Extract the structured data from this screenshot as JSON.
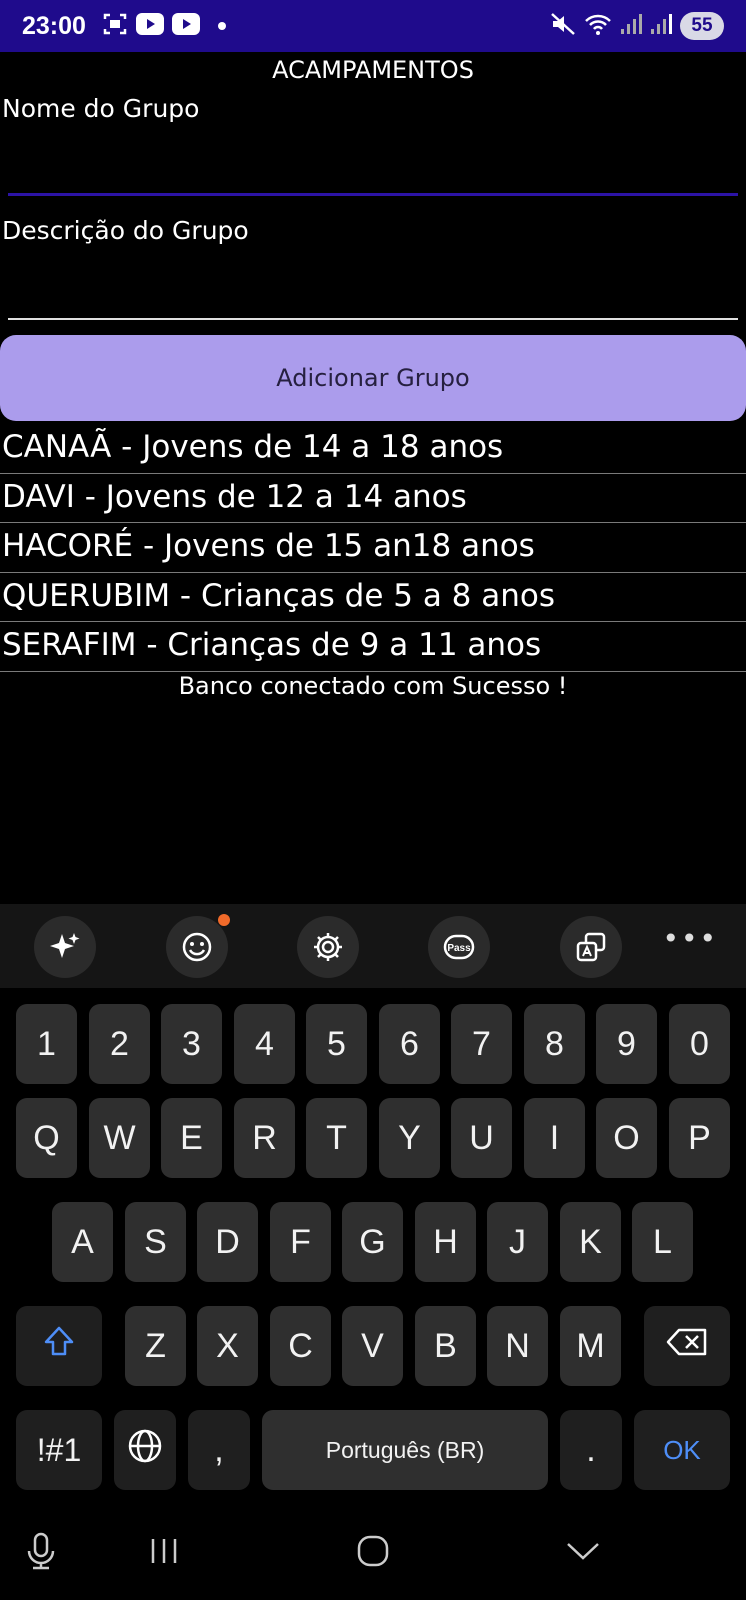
{
  "status_bar": {
    "time": "23:00",
    "battery": "55",
    "icons": [
      "screenshot-icon",
      "youtube-icon",
      "youtube-icon",
      "mute-icon",
      "wifi-icon",
      "signal-icon",
      "signal-icon"
    ]
  },
  "app": {
    "title": "ACAMPAMENTOS",
    "name_label": "Nome do Grupo",
    "name_value": "",
    "description_label": "Descrição do Grupo",
    "description_value": "",
    "add_button": "Adicionar Grupo",
    "groups": [
      "CANAÃ - Jovens de 14 a 18 anos",
      "DAVI - Jovens de 12 a 14 anos",
      "HACORÉ - Jovens de 15 an18 anos",
      "QUERUBIM - Crianças de 5 a 8 anos",
      "SERAFIM - Crianças de 9 a 11 anos"
    ],
    "status_message": "Banco conectado com Sucesso !"
  },
  "keyboard": {
    "toolbar": [
      "ai-sparkle-icon",
      "emoji-icon",
      "settings-icon",
      "pass-icon",
      "translate-icon",
      "more-icon"
    ],
    "more": "•••",
    "pass_label": "Pass",
    "row_numbers": [
      "1",
      "2",
      "3",
      "4",
      "5",
      "6",
      "7",
      "8",
      "9",
      "0"
    ],
    "row_top": [
      "Q",
      "W",
      "E",
      "R",
      "T",
      "Y",
      "U",
      "I",
      "O",
      "P"
    ],
    "row_middle": [
      "A",
      "S",
      "D",
      "F",
      "G",
      "H",
      "J",
      "K",
      "L"
    ],
    "row_bottom": [
      "Z",
      "X",
      "C",
      "V",
      "B",
      "N",
      "M"
    ],
    "symbols_key": "!#1",
    "comma_key": ",",
    "space_label": "Português (BR)",
    "period_key": ".",
    "ok_key": "OK"
  },
  "nav_bar": [
    "microphone-icon",
    "recent-apps-icon",
    "home-icon",
    "back-icon"
  ],
  "colors": {
    "status_bar": "#1f0b8c",
    "button": "#ab9cec",
    "accent_line": "#2c13a6",
    "ok_text": "#4e8ef7"
  }
}
